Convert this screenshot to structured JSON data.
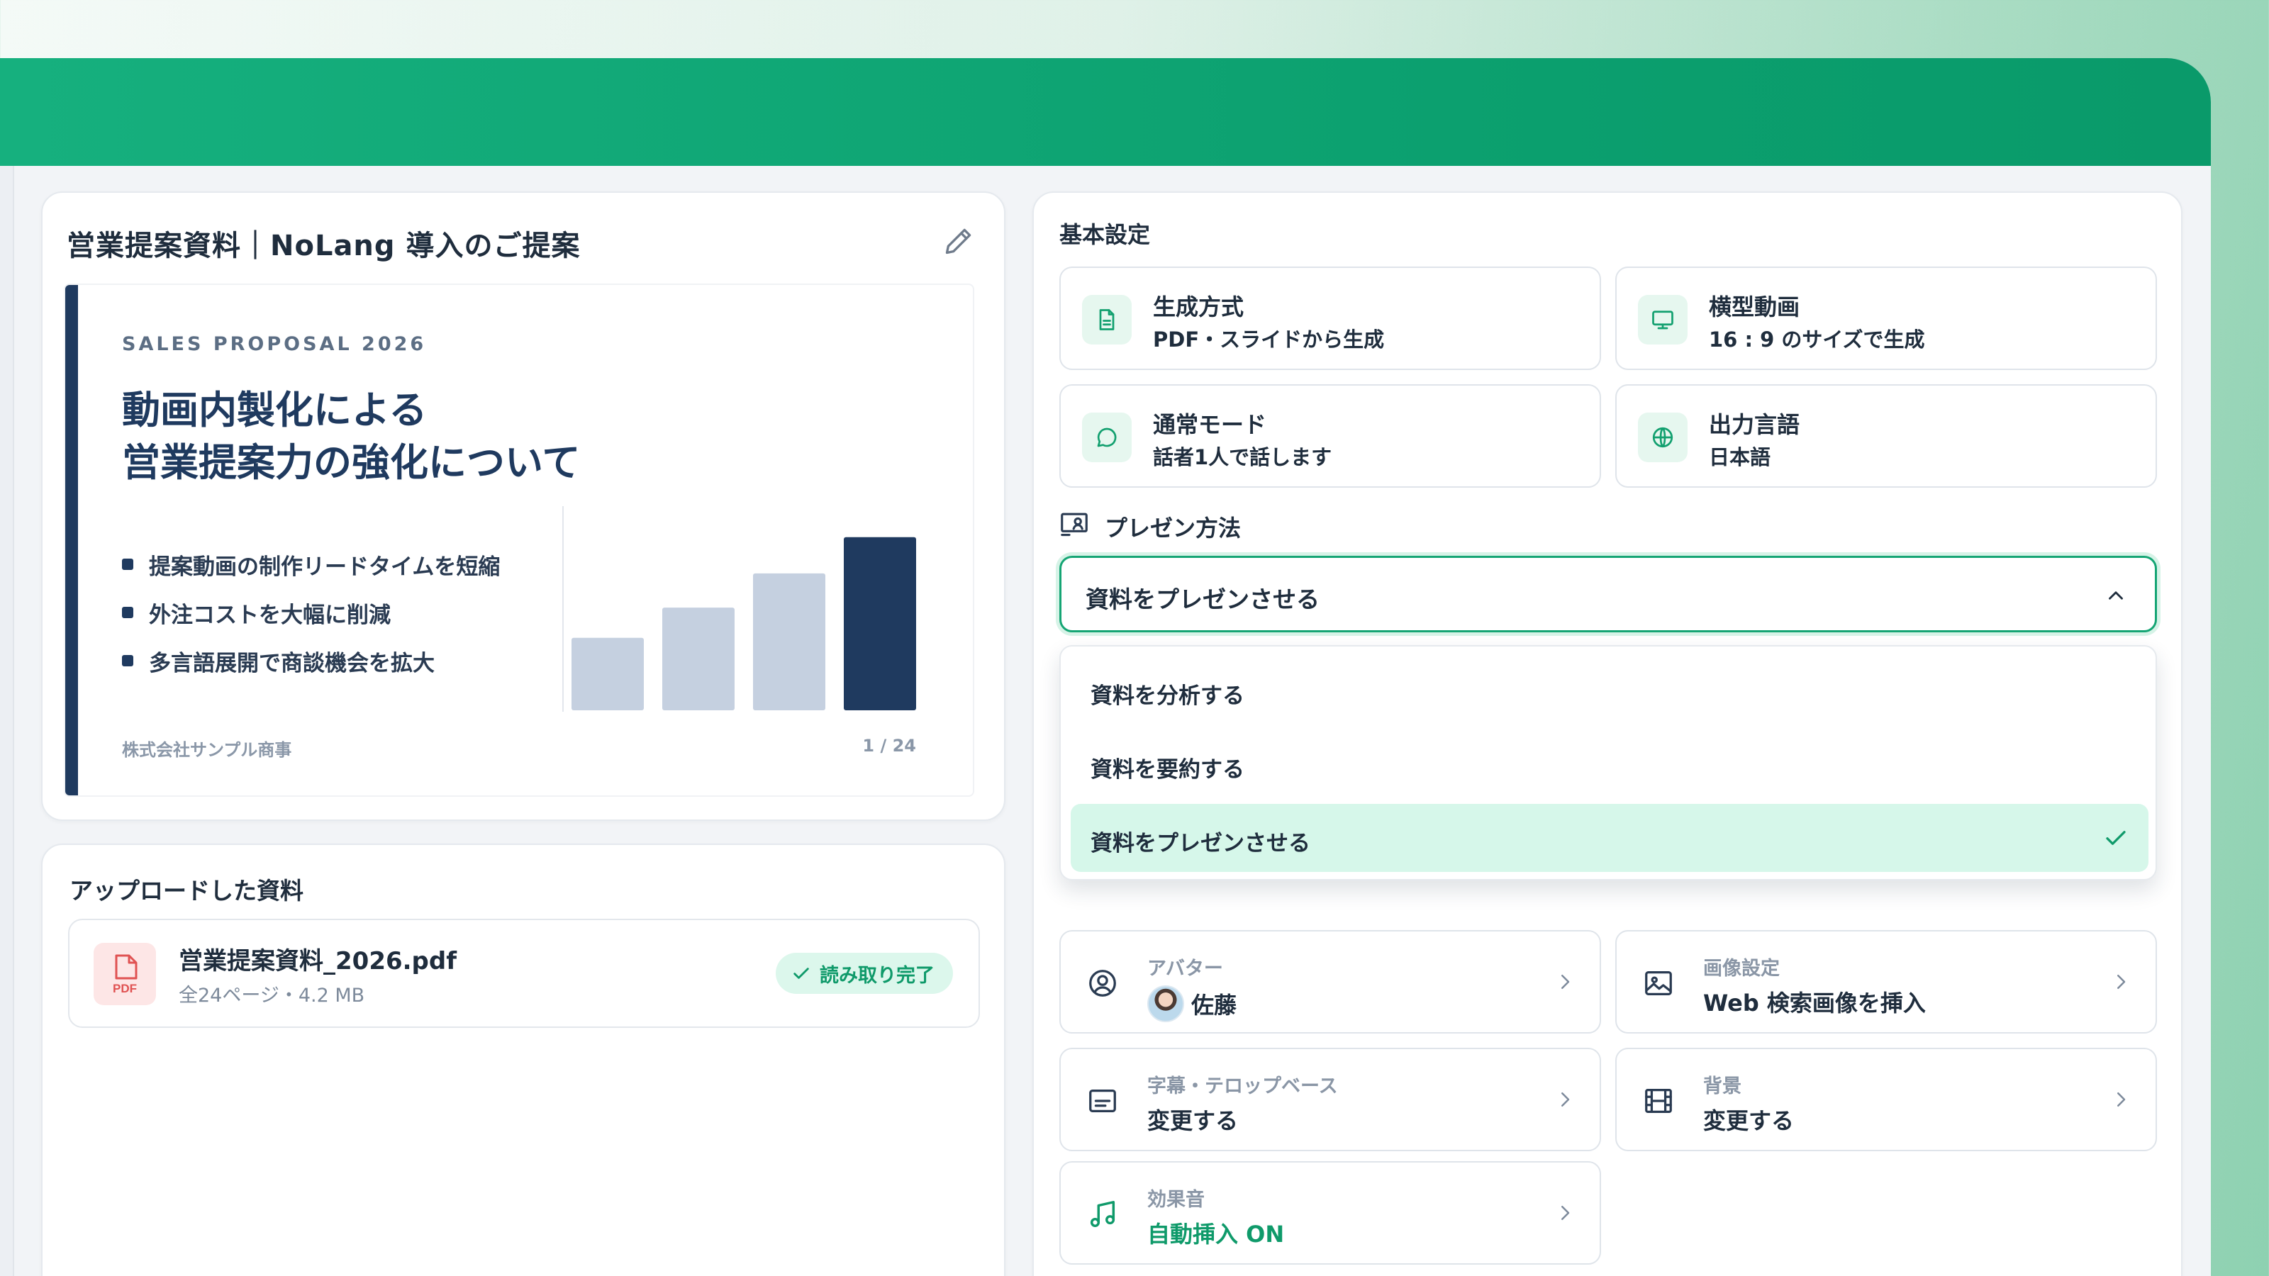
{
  "preview": {
    "title": "営業提案資料｜NoLang 導入のご提案",
    "slide": {
      "eyebrow": "SALES PROPOSAL 2026",
      "title_line1": "動画内製化による",
      "title_line2": "営業提案力の強化について",
      "bullets": [
        "提案動画の制作リードタイムを短縮",
        "外注コストを大幅に削減",
        "多言語展開で商談機会を拡大"
      ],
      "company": "株式会社サンプル商事",
      "page": "1 / 24"
    }
  },
  "chart_data": {
    "type": "bar",
    "categories": [
      "",
      "",
      "",
      ""
    ],
    "values": [
      36,
      51,
      68,
      86
    ],
    "ylim": [
      0,
      100
    ],
    "highlight_index": 3,
    "colors": {
      "default": "#c5d0e0",
      "highlight": "#1f3a5f"
    }
  },
  "upload": {
    "title": "アップロードした資料",
    "file": {
      "icon_label": "PDF",
      "name": "営業提案資料_2026.pdf",
      "meta": "全24ページ・4.2 MB",
      "status": "読み取り完了"
    }
  },
  "settings": {
    "basic_label": "基本設定",
    "tiles": [
      {
        "icon": "document-icon",
        "title": "生成方式",
        "sub": "PDF・スライドから生成"
      },
      {
        "icon": "monitor-icon",
        "title": "横型動画",
        "sub": "16 : 9 のサイズで生成"
      },
      {
        "icon": "chat-bubble-icon",
        "title": "通常モード",
        "sub": "話者1人で話します"
      },
      {
        "icon": "globe-icon",
        "title": "出力言語",
        "sub": "日本語"
      }
    ],
    "present_label": "プレゼン方法",
    "present_selected": "資料をプレゼンさせる",
    "present_options": [
      "資料を分析する",
      "資料を要約する",
      "資料をプレゼンさせる"
    ],
    "options": [
      {
        "icon": "user-circle-icon",
        "label": "アバター",
        "value": "佐藤"
      },
      {
        "icon": "image-icon",
        "label": "画像設定",
        "value": "Web 検索画像を挿入"
      },
      {
        "icon": "subtitle-icon",
        "label": "字幕・テロップベース",
        "value": "変更する"
      },
      {
        "icon": "film-icon",
        "label": "背景",
        "value": "変更する"
      },
      {
        "icon": "music-note-icon",
        "label": "効果音",
        "value": "自動挿入 ON"
      }
    ]
  },
  "colors": {
    "brand": "#0ea572",
    "navy": "#1f3a5f",
    "accent_light": "#d6f7ea"
  }
}
